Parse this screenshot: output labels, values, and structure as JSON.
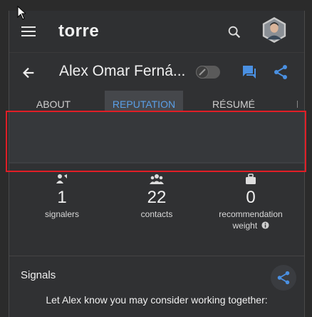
{
  "header": {
    "logo": "torre"
  },
  "profile": {
    "name": "Alex Omar Ferná..."
  },
  "tabs": [
    {
      "label": "ABOUT",
      "active": false
    },
    {
      "label": "REPUTATION",
      "active": true
    },
    {
      "label": "RÉSUMÉ",
      "active": false
    }
  ],
  "stats": [
    {
      "value": "1",
      "label": "signalers",
      "icon": "signaler-icon"
    },
    {
      "value": "22",
      "label": "contacts",
      "icon": "contacts-icon"
    },
    {
      "value": "0",
      "label": "recommendation",
      "label2": "weight",
      "icon": "bag-icon"
    }
  ],
  "signals": {
    "title": "Signals",
    "prompt": "Let Alex know you may consider working together:"
  },
  "colors": {
    "accent": "#4a90e2",
    "highlight": "#e01e26",
    "background": "#303133"
  }
}
